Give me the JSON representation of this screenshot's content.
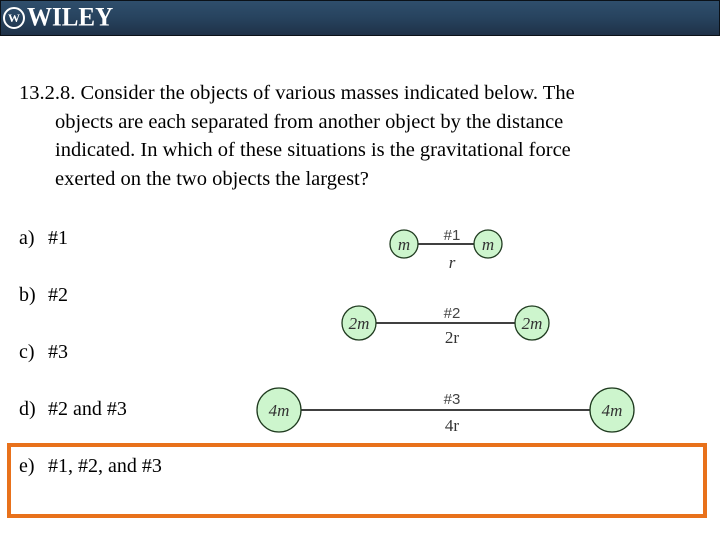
{
  "header": {
    "brand": "WILEY",
    "logo_icon": "wiley-seal-icon",
    "colors": {
      "bar_top": "#2f4e6c",
      "bar_bottom": "#1f3148"
    }
  },
  "question": {
    "lines": [
      "13.2.8. Consider the objects of various masses indicated below.  The",
      "objects are each separated from another object by the distance",
      "indicated.  In which of these situations is the gravitational force",
      "exerted on the two objects the largest?"
    ]
  },
  "answers": [
    {
      "letter": "a)",
      "text": "#1"
    },
    {
      "letter": "b)",
      "text": "#2"
    },
    {
      "letter": "c)",
      "text": "#3"
    },
    {
      "letter": "d)",
      "text": "#2 and #3"
    },
    {
      "letter": "e)",
      "text": "#1, #2, and #3"
    }
  ],
  "highlighted_answer": "e)",
  "highlight_color": "#e8711b",
  "diagram": {
    "ball_color": "#cdf5cd",
    "systems": [
      {
        "label": "#1",
        "left_mass": "m",
        "right_mass": "m",
        "distance": "r"
      },
      {
        "label": "#2",
        "left_mass": "2m",
        "right_mass": "2m",
        "distance": "2r"
      },
      {
        "label": "#3",
        "left_mass": "4m",
        "right_mass": "4m",
        "distance": "4r"
      }
    ]
  }
}
